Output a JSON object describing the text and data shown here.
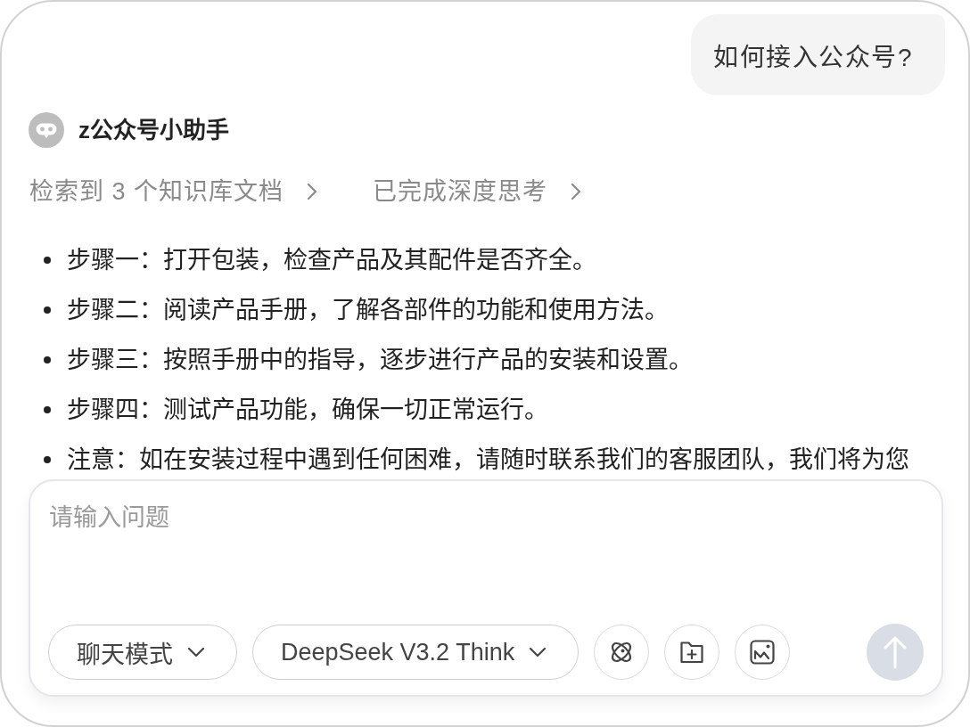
{
  "user_message": {
    "text": "如何接入公众号?"
  },
  "assistant": {
    "name": "z公众号小助手",
    "status_links": [
      {
        "text": "检索到 3 个知识库文档",
        "expanded": false
      },
      {
        "text": "已完成深度思考",
        "expanded": false
      }
    ],
    "bullets": [
      "步骤一：打开包装，检查产品及其配件是否齐全。",
      "步骤二：阅读产品手册，了解各部件的功能和使用方法。",
      "步骤三：按照手册中的指导，逐步进行产品的安装和设置。",
      "步骤四：测试产品功能，确保一切正常运行。",
      "注意：如在安装过程中遇到任何困难，请随时联系我们的客服团队，我们将为您"
    ]
  },
  "composer": {
    "placeholder": "请输入问题",
    "dropdowns": [
      {
        "label": "聊天模式"
      },
      {
        "label": "DeepSeek V3.2 Think"
      }
    ],
    "tool_buttons": [
      {
        "kind": "atom"
      },
      {
        "kind": "folder"
      },
      {
        "kind": "image"
      }
    ],
    "send_button": {
      "disabled": true
    }
  }
}
